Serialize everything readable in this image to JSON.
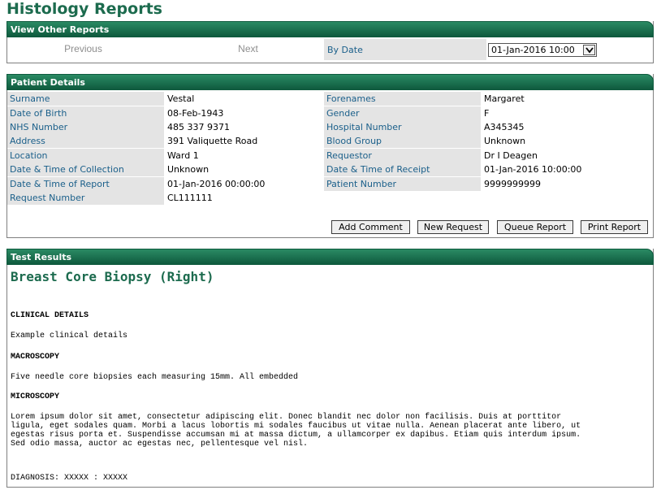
{
  "page_title": "Histology Reports",
  "view_other": {
    "header": "View Other Reports",
    "previous": "Previous",
    "next": "Next",
    "by_date_label": "By Date",
    "date_value": "01-Jan-2016 10:00"
  },
  "patient": {
    "header": "Patient Details",
    "left": [
      {
        "label": "Surname",
        "value": "Vestal"
      },
      {
        "label": "Date of Birth",
        "value": "08-Feb-1943"
      },
      {
        "label": "NHS Number",
        "value": "485 337 9371"
      },
      {
        "label": "Address",
        "value": "391 Valiquette Road"
      },
      {
        "label": "Location",
        "value": "Ward 1"
      },
      {
        "label": "Date & Time of Collection",
        "value": "Unknown"
      },
      {
        "label": "Date & Time of Report",
        "value": "01-Jan-2016 00:00:00"
      },
      {
        "label": "Request Number",
        "value": "CL111111"
      }
    ],
    "right": [
      {
        "label": "Forenames",
        "value": "Margaret"
      },
      {
        "label": "Gender",
        "value": "F"
      },
      {
        "label": "Hospital Number",
        "value": "A345345"
      },
      {
        "label": "Blood Group",
        "value": "Unknown"
      },
      {
        "label": "Requestor",
        "value": "Dr I Deagen"
      },
      {
        "label": "Date & Time of Receipt",
        "value": "01-Jan-2016 10:00:00"
      },
      {
        "label": "Patient Number",
        "value": "9999999999"
      }
    ],
    "buttons": {
      "add_comment": "Add Comment",
      "new_request": "New Request",
      "queue_report": "Queue Report",
      "print_report": "Print Report"
    }
  },
  "results": {
    "header": "Test Results",
    "title": "Breast Core Biopsy (Right)",
    "clinical_heading": "CLINICAL DETAILS",
    "clinical_text": "Example clinical details",
    "macro_heading": "MACROSCOPY",
    "macro_text": "Five needle core biopsies each measuring 15mm. All embedded",
    "micro_heading": "MICROSCOPY",
    "micro_lines": [
      "Lorem ipsum dolor sit amet, consectetur adipiscing elit. Donec blandit nec dolor non facilisis. Duis at porttitor",
      "ligula, eget sodales quam. Morbi a lacus lobortis mi sodales faucibus ut vitae nulla. Aenean placerat ante libero, ut",
      "egestas risus porta et. Suspendisse accumsan mi at massa dictum, a ullamcorper ex dapibus. Etiam quis interdum ipsum.",
      "Sed odio massa, auctor ac egestas nec, pellentesque vel nisl."
    ],
    "diagnosis": "DIAGNOSIS: XXXXX : XXXXX"
  },
  "colors": {
    "accent": "#1c6b4e",
    "label_text": "#1a5f8a",
    "label_bg": "#e4e4e4"
  }
}
